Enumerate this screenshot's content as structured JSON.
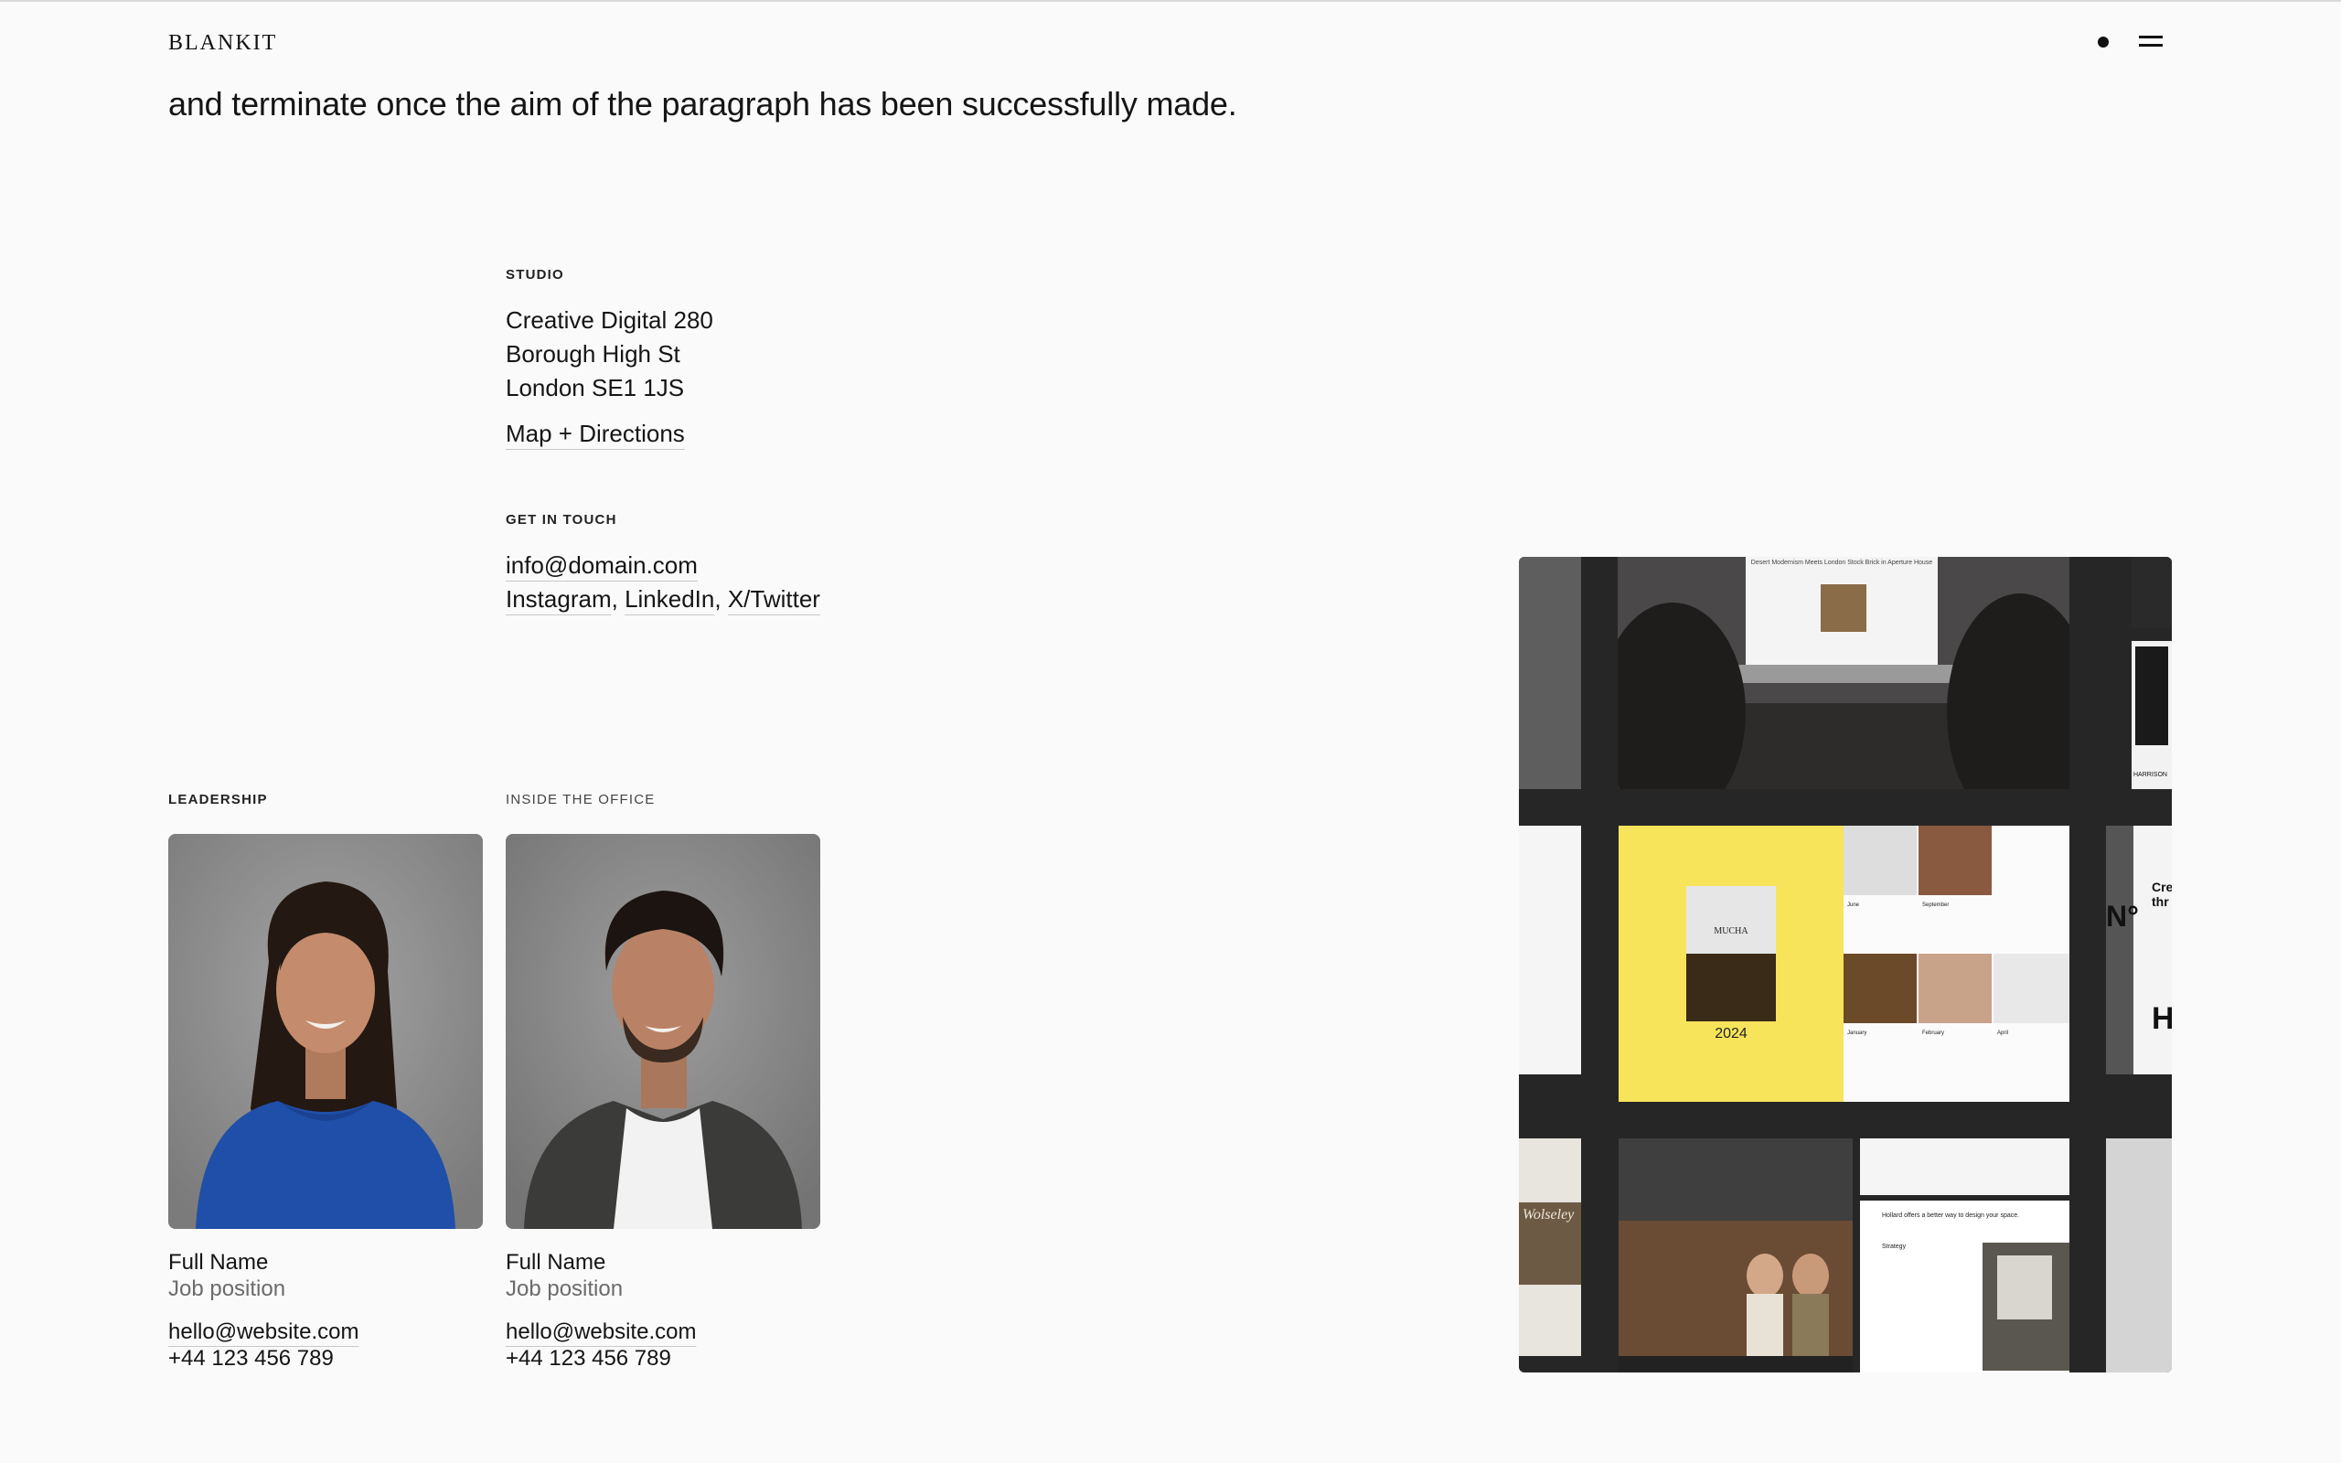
{
  "header": {
    "logo": "BLANKIT",
    "menu_icon": "menu-icon",
    "dot_icon": "dot-icon"
  },
  "intro": {
    "text": "and terminate once the aim of the paragraph has been successfully made."
  },
  "studio": {
    "label": "STUDIO",
    "address": [
      "Creative Digital 280",
      "Borough High St",
      "London SE1 1JS"
    ],
    "map_link": "Map + Directions"
  },
  "contact": {
    "label": "GET IN TOUCH",
    "email": "info@domain.com",
    "social_links": [
      "Instagram",
      "LinkedIn",
      "X/Twitter"
    ]
  },
  "leadership": {
    "label": "LEADERSHIP",
    "name": "Full Name",
    "position": "Job position",
    "email": "hello@website.com",
    "phone": "+44 123 456 789"
  },
  "office": {
    "label": "INSIDE THE OFFICE",
    "name": "Full Name",
    "position": "Job position",
    "email": "hello@website.com",
    "phone": "+44 123 456 789"
  },
  "gallery": {
    "year": "2024",
    "book_title": "MUCHA",
    "spread_caption": "Desert Modernism Meets London Stock Brick in Aperture House",
    "brand_mark": "HARRISON",
    "months": [
      "June",
      "September",
      "January",
      "February",
      "April"
    ],
    "side_letters": [
      "N°",
      "H",
      "Cre",
      "thr"
    ],
    "side_word": "Wolseley",
    "article_heading": "Hollard offers a better way to design your space.",
    "article_sub": "Strategy",
    "colors": {
      "yellow": "#f7e45a",
      "dark": "#262626"
    }
  }
}
